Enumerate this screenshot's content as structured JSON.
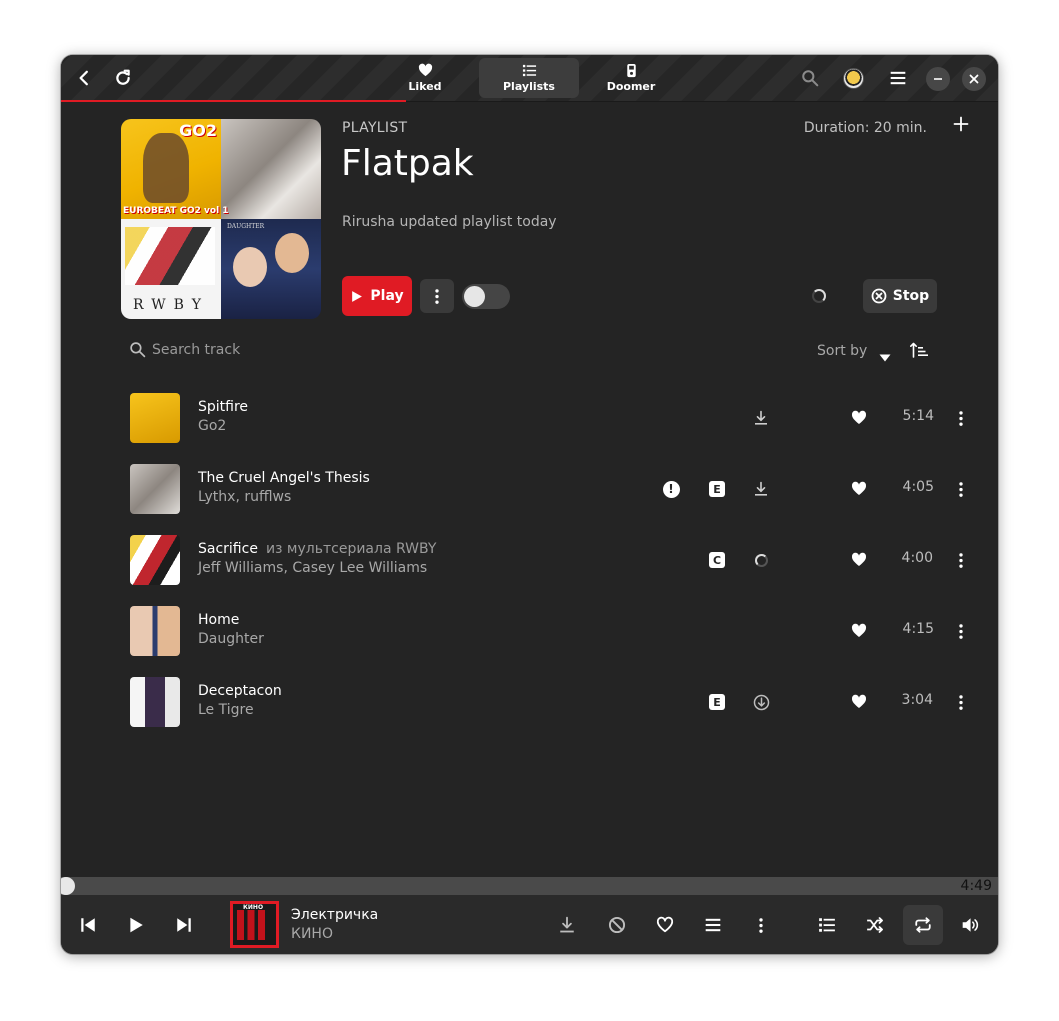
{
  "header": {
    "tabs": [
      {
        "label": "Liked",
        "icon": "heart-icon",
        "active": false
      },
      {
        "label": "Playlists",
        "icon": "list-icon",
        "active": true
      },
      {
        "label": "Doomer",
        "icon": "device-icon",
        "active": false
      }
    ]
  },
  "playlist": {
    "kind_label": "PLAYLIST",
    "title": "Flatpak",
    "subtitle": "Rirusha updated playlist today",
    "duration": "Duration: 20 min.",
    "play_label": "Play",
    "stop_label": "Stop",
    "cover_texts": {
      "go2": "GO2",
      "eurobeat": "EUROBEAT GO2 vol 1",
      "rwby": "RWBY",
      "daughter": "DAUGHTER"
    }
  },
  "controls": {
    "search_placeholder": "Search track",
    "sort_label": "Sort by"
  },
  "tracks": [
    {
      "title": "Spitfire",
      "extra": "",
      "artist": "Go2",
      "duration": "5:14",
      "explicit": false,
      "warning": false,
      "download": "download",
      "liked": true
    },
    {
      "title": "The Cruel Angel's Thesis",
      "extra": "",
      "artist": "Lythx, rufflws",
      "duration": "4:05",
      "explicit": true,
      "warning": true,
      "download": "download",
      "liked": true
    },
    {
      "title": "Sacrifice",
      "extra": "из мультсериала RWBY",
      "artist": "Jeff Williams, Casey Lee Williams",
      "duration": "4:00",
      "badge": "C",
      "warning": false,
      "download": "loading",
      "liked": true
    },
    {
      "title": "Home",
      "extra": "",
      "artist": "Daughter",
      "duration": "4:15",
      "explicit": false,
      "warning": false,
      "download": "none",
      "liked": true
    },
    {
      "title": "Deceptacon",
      "extra": "",
      "artist": "Le Tigre",
      "duration": "3:04",
      "explicit": true,
      "warning": false,
      "download": "downloaded",
      "liked": true
    }
  ],
  "player": {
    "elapsed_label": "4:49",
    "title": "Электричка",
    "artist": "КИНО",
    "thumb_text": "КИНО"
  },
  "colors": {
    "accent": "#e01b24",
    "window_bg": "#242424",
    "header_bg": "#2a2a2a"
  }
}
